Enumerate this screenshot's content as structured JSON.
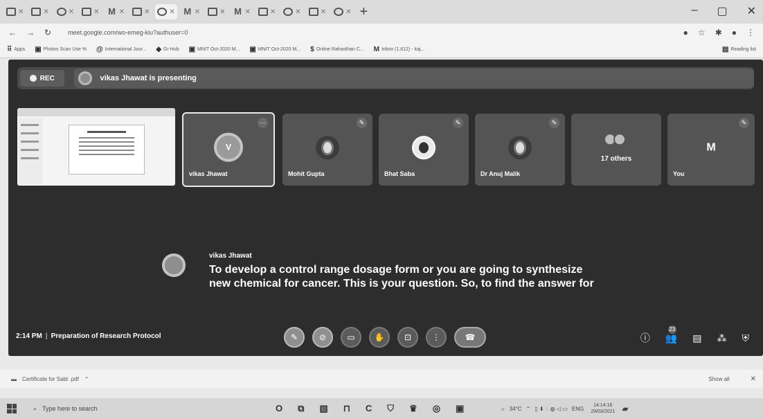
{
  "browser": {
    "tabs": [
      "",
      "",
      "",
      "",
      "",
      "",
      "",
      "",
      "",
      "",
      "",
      "",
      "",
      ""
    ],
    "url": "meet.google.com/wo-emeg-kiu?authuser=0",
    "window_controls": [
      "–",
      "▢",
      "✕"
    ],
    "bookmarks": [
      {
        "label": "Apps"
      },
      {
        "label": "Photos Scan Use %"
      },
      {
        "label": "International Jour..."
      },
      {
        "label": "Gr Hub"
      },
      {
        "label": "MNIT Oct-2020 M..."
      },
      {
        "label": "MNIT Oct-2020 M..."
      },
      {
        "label": "Online Rahasthan C..."
      },
      {
        "label": "Inbox (1,612) - kaj..."
      }
    ],
    "reading_list": "Reading list"
  },
  "meet": {
    "rec_label": "REC",
    "presenting_text": "vikas Jhawat is presenting",
    "participants": [
      {
        "name": "vikas Jhawat",
        "avatar_letter": "V"
      },
      {
        "name": "Mohit Gupta"
      },
      {
        "name": "Bhat Saba"
      },
      {
        "name": "Dr Anuj Malik"
      },
      {
        "name": "17 others"
      },
      {
        "name": "You",
        "avatar_letter": "M"
      }
    ],
    "caption": {
      "speaker": "vikas Jhawat",
      "text": "To develop a control range dosage form or you are going to synthesize new chemical for cancer. This is your question. So, to find the answer for"
    },
    "time": "2:14 PM",
    "separator": "|",
    "meeting_title": "Preparation of Research Protocol",
    "people_count": "23"
  },
  "downloads": {
    "file": "Certificate for Sabt .pdf",
    "show_all": "Show all"
  },
  "taskbar": {
    "search_placeholder": "Type here to search",
    "temperature": "34°C",
    "language": "ENG",
    "time": "14:14:16",
    "date": "29/03/2021"
  }
}
